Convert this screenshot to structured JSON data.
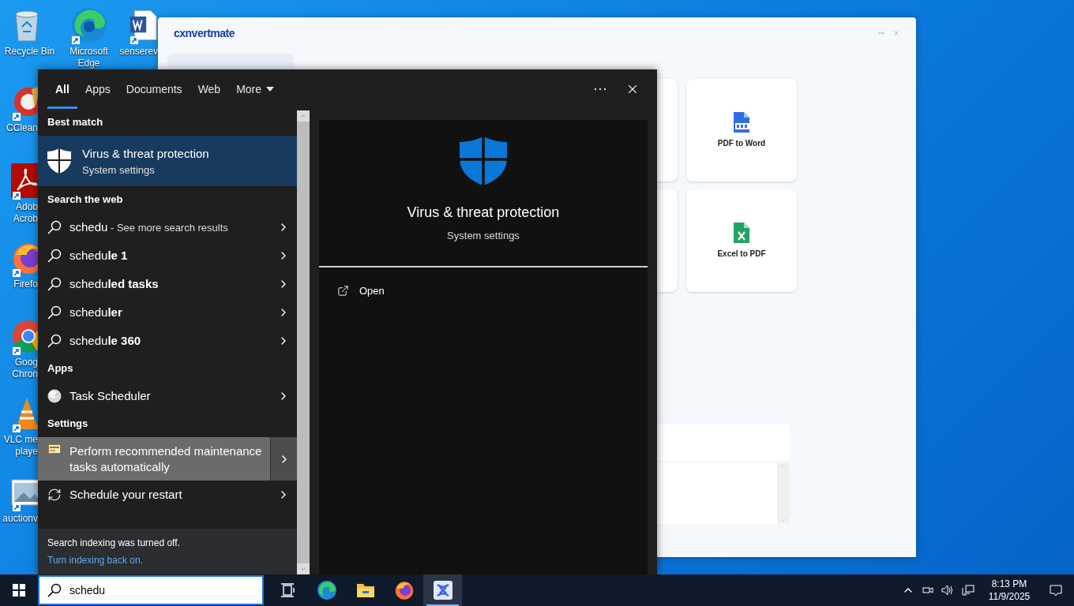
{
  "desktop_icons": [
    {
      "kind": "recycle",
      "label": "Recycle Bin"
    },
    {
      "kind": "edge",
      "label": "Microsoft Edge"
    },
    {
      "kind": "word",
      "label": "senserev"
    },
    {
      "kind": "ccleaner",
      "label": "CClean"
    },
    {
      "kind": "acrobat",
      "label": "Adob Acrob"
    },
    {
      "kind": "firefox",
      "label": "Firefo"
    },
    {
      "kind": "chrome",
      "label": "Goog Chron"
    },
    {
      "kind": "vlc",
      "label": "VLC me playe"
    },
    {
      "kind": "image",
      "label": "auctionv"
    }
  ],
  "app_window": {
    "logo": "cxnvertmate",
    "tools": [
      {
        "kind": "pdf",
        "label": "PDF to Word"
      },
      {
        "kind": "excel",
        "label": "Excel to PDF"
      }
    ]
  },
  "search": {
    "tabs": [
      {
        "label": "All",
        "selected": true,
        "dropdown": false
      },
      {
        "label": "Apps",
        "selected": false,
        "dropdown": false
      },
      {
        "label": "Documents",
        "selected": false,
        "dropdown": false
      },
      {
        "label": "Web",
        "selected": false,
        "dropdown": false
      },
      {
        "label": "More",
        "selected": false,
        "dropdown": true
      }
    ],
    "sections": [
      {
        "header": "Best match",
        "items": [
          {
            "kind": "shield",
            "title": "Virus & threat protection",
            "subtitle": "System settings",
            "selected": true,
            "hovered": false
          }
        ]
      },
      {
        "header": "Search the web",
        "items": [
          {
            "kind": "web",
            "title": "schedu",
            "note": "- See more search results",
            "selected": false,
            "hovered": false
          },
          {
            "kind": "web",
            "title": "schedu**le 1**",
            "selected": false,
            "hovered": false
          },
          {
            "kind": "web",
            "title": "schedu**led tasks**",
            "selected": false,
            "hovered": false
          },
          {
            "kind": "web",
            "title": "schedu**ler**",
            "selected": false,
            "hovered": false
          },
          {
            "kind": "web",
            "title": "schedu**le 360**",
            "selected": false,
            "hovered": false
          }
        ]
      },
      {
        "header": "Apps",
        "items": [
          {
            "kind": "app",
            "title": "Task Scheduler",
            "selected": false,
            "hovered": false
          }
        ]
      },
      {
        "header": "Settings",
        "items": [
          {
            "kind": "maintenance",
            "title": "Perform recommended maintenance tasks automatically",
            "selected": false,
            "hovered": true
          },
          {
            "kind": "restart",
            "title": "Schedule your restart",
            "selected": false,
            "hovered": false
          }
        ]
      }
    ],
    "footer": {
      "message": "Search indexing was turned off.",
      "link": "Turn indexing back on."
    },
    "preview": {
      "title": "Virus & threat protection",
      "subtitle": "System settings",
      "actions": [
        {
          "kind": "open",
          "label": "Open"
        }
      ]
    }
  },
  "taskbar": {
    "search_value": "schedu",
    "apps": [
      {
        "kind": "taskview",
        "active": false
      },
      {
        "kind": "edge",
        "active": false
      },
      {
        "kind": "explorer",
        "active": false
      },
      {
        "kind": "firefox",
        "active": false
      },
      {
        "kind": "convertmate",
        "active": true
      }
    ],
    "time": "8:13 PM",
    "date": "11/9/2025"
  }
}
